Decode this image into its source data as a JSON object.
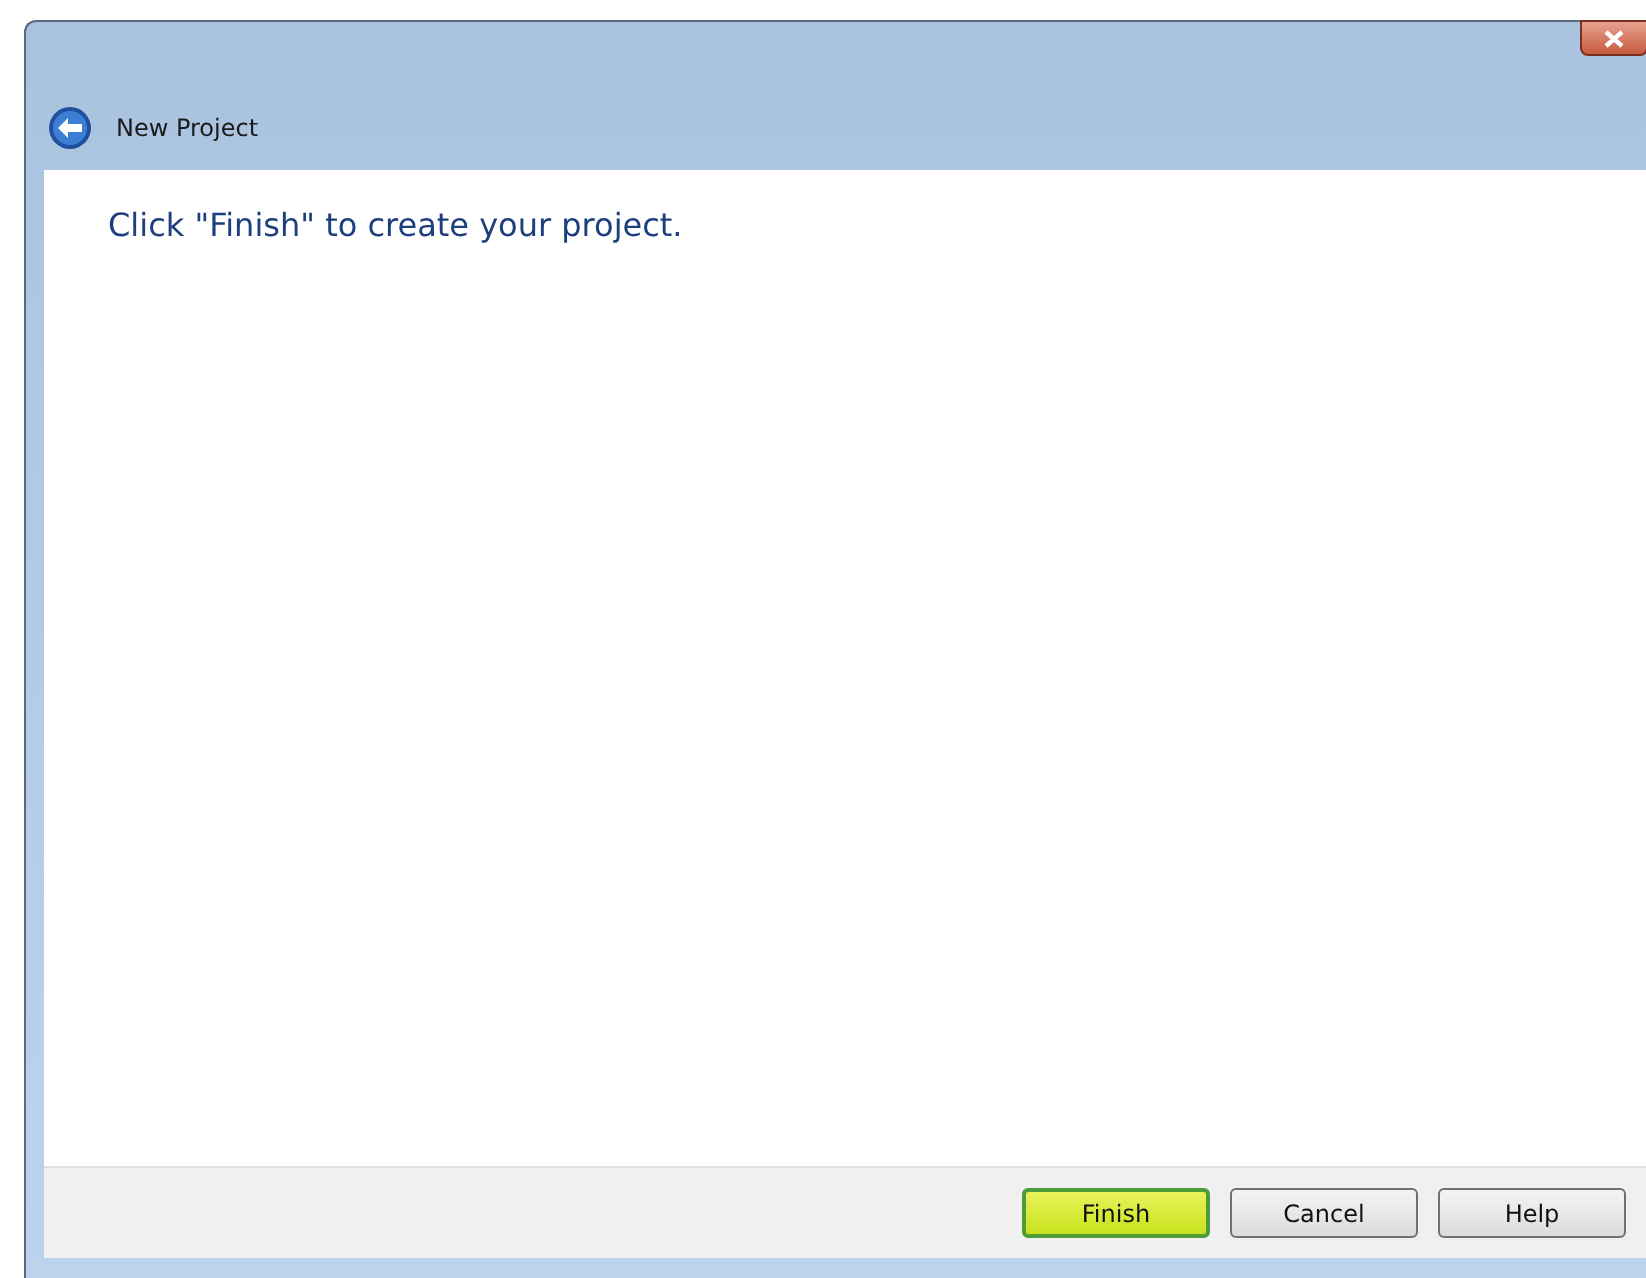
{
  "window": {
    "title": "New Project"
  },
  "message": "Click \"Finish\" to create your project.",
  "buttons": [
    {
      "label": "Finish",
      "default": true
    },
    {
      "label": "Cancel",
      "default": false
    },
    {
      "label": "Help",
      "default": false
    }
  ]
}
